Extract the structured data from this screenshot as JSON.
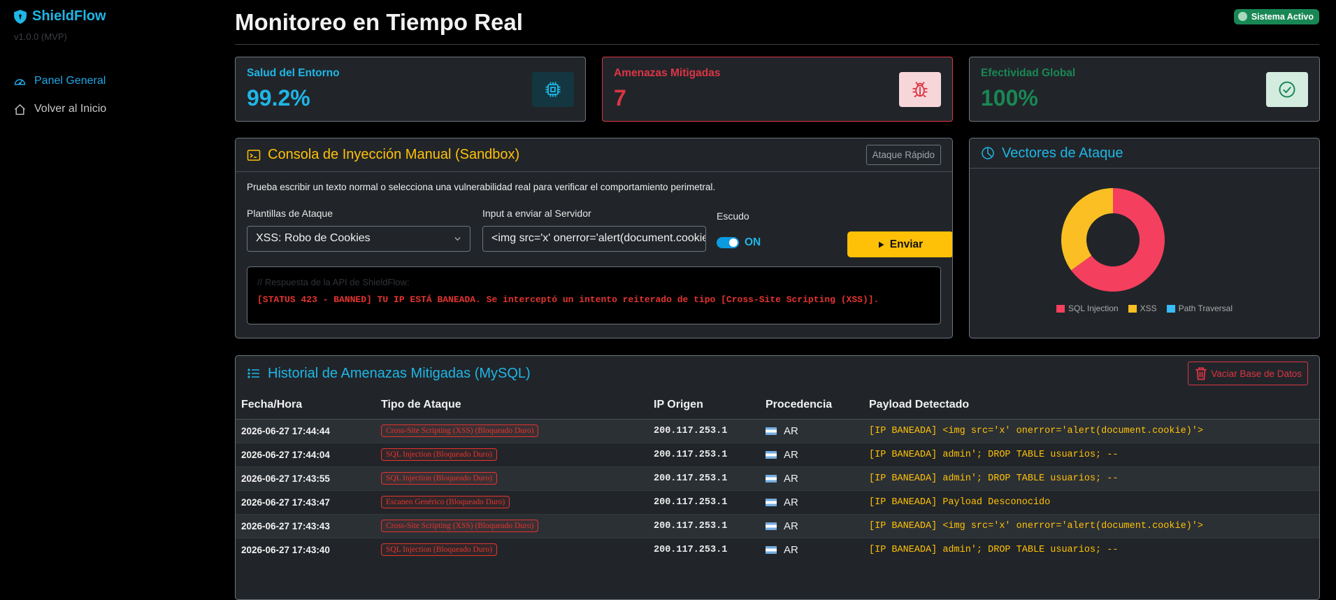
{
  "sidebar": {
    "brand": "ShieldFlow",
    "version": "v1.0.0 (MVP)",
    "items": [
      {
        "label": "Panel General"
      },
      {
        "label": "Volver al Inicio"
      }
    ]
  },
  "header": {
    "title": "Monitoreo en Tiempo Real",
    "status": "Sistema Activo"
  },
  "kpis": [
    {
      "label": "Salud del Entorno",
      "value": "99.2%",
      "color": "#1fb6e6",
      "icon": "cpu-icon"
    },
    {
      "label": "Amenazas Mitigadas",
      "value": "7",
      "color": "#dc3545",
      "icon": "bug-icon"
    },
    {
      "label": "Efectividad Global",
      "value": "100%",
      "color": "#198754",
      "icon": "check-circle-icon"
    }
  ],
  "console": {
    "title": "Consola de Inyección Manual (Sandbox)",
    "quick_attack": "Ataque Rápido",
    "help": "Prueba escribir un texto normal o selecciona una vulnerabilidad real para verificar el comportamiento perimetral.",
    "template_label": "Plantillas de Ataque",
    "template_value": "XSS: Robo de Cookies",
    "input_label": "Input a enviar al Servidor",
    "input_value": "<img src='x' onerror='alert(document.cookie)'>",
    "shield_label": "Escudo",
    "shield_state": "ON",
    "send": "Enviar",
    "terminal_comment": "// Respuesta de la API de ShieldFlow:",
    "terminal_response": "[STATUS 423 - BANNED] TU IP ESTÁ BANEADA. Se interceptó un intento reiterado de tipo [Cross-Site Scripting (XSS)]."
  },
  "vectors": {
    "title": "Vectores de Ataque"
  },
  "chart_data": {
    "type": "pie",
    "donut": true,
    "categories": [
      "SQL Injection",
      "XSS",
      "Path Traversal"
    ],
    "values": [
      65,
      35,
      0
    ],
    "colors": [
      "#f43f5e",
      "#fbbf24",
      "#38bdf8"
    ],
    "legend": "bottom"
  },
  "history": {
    "title": "Historial de Amenazas Mitigadas (MySQL)",
    "clear": "Vaciar Base de Datos",
    "columns": [
      "Fecha/Hora",
      "Tipo de Ataque",
      "IP Origen",
      "Procedencia",
      "Payload Detectado"
    ],
    "rows": [
      {
        "date": "2026-06-27 17:44:44",
        "type": "Cross-Site Scripting (XSS) (Bloqueado Duro)",
        "ip": "200.117.253.1",
        "country": "AR",
        "payload": "[IP BANEADA] <img src='x' onerror='alert(document.cookie)'>"
      },
      {
        "date": "2026-06-27 17:44:04",
        "type": "SQL Injection (Bloqueado Duro)",
        "ip": "200.117.253.1",
        "country": "AR",
        "payload": "[IP BANEADA] admin'; DROP TABLE usuarios; --"
      },
      {
        "date": "2026-06-27 17:43:55",
        "type": "SQL Injection (Bloqueado Duro)",
        "ip": "200.117.253.1",
        "country": "AR",
        "payload": "[IP BANEADA] admin'; DROP TABLE usuarios; --"
      },
      {
        "date": "2026-06-27 17:43:47",
        "type": "Escaneo Genérico (Bloqueado Duro)",
        "ip": "200.117.253.1",
        "country": "AR",
        "payload": "[IP BANEADA] Payload Desconocido"
      },
      {
        "date": "2026-06-27 17:43:43",
        "type": "Cross-Site Scripting (XSS) (Bloqueado Duro)",
        "ip": "200.117.253.1",
        "country": "AR",
        "payload": "[IP BANEADA] <img src='x' onerror='alert(document.cookie)'>"
      },
      {
        "date": "2026-06-27 17:43:40",
        "type": "SQL Injection (Bloqueado Duro)",
        "ip": "200.117.253.1",
        "country": "AR",
        "payload": "[IP BANEADA] admin'; DROP TABLE usuarios; --"
      }
    ]
  }
}
